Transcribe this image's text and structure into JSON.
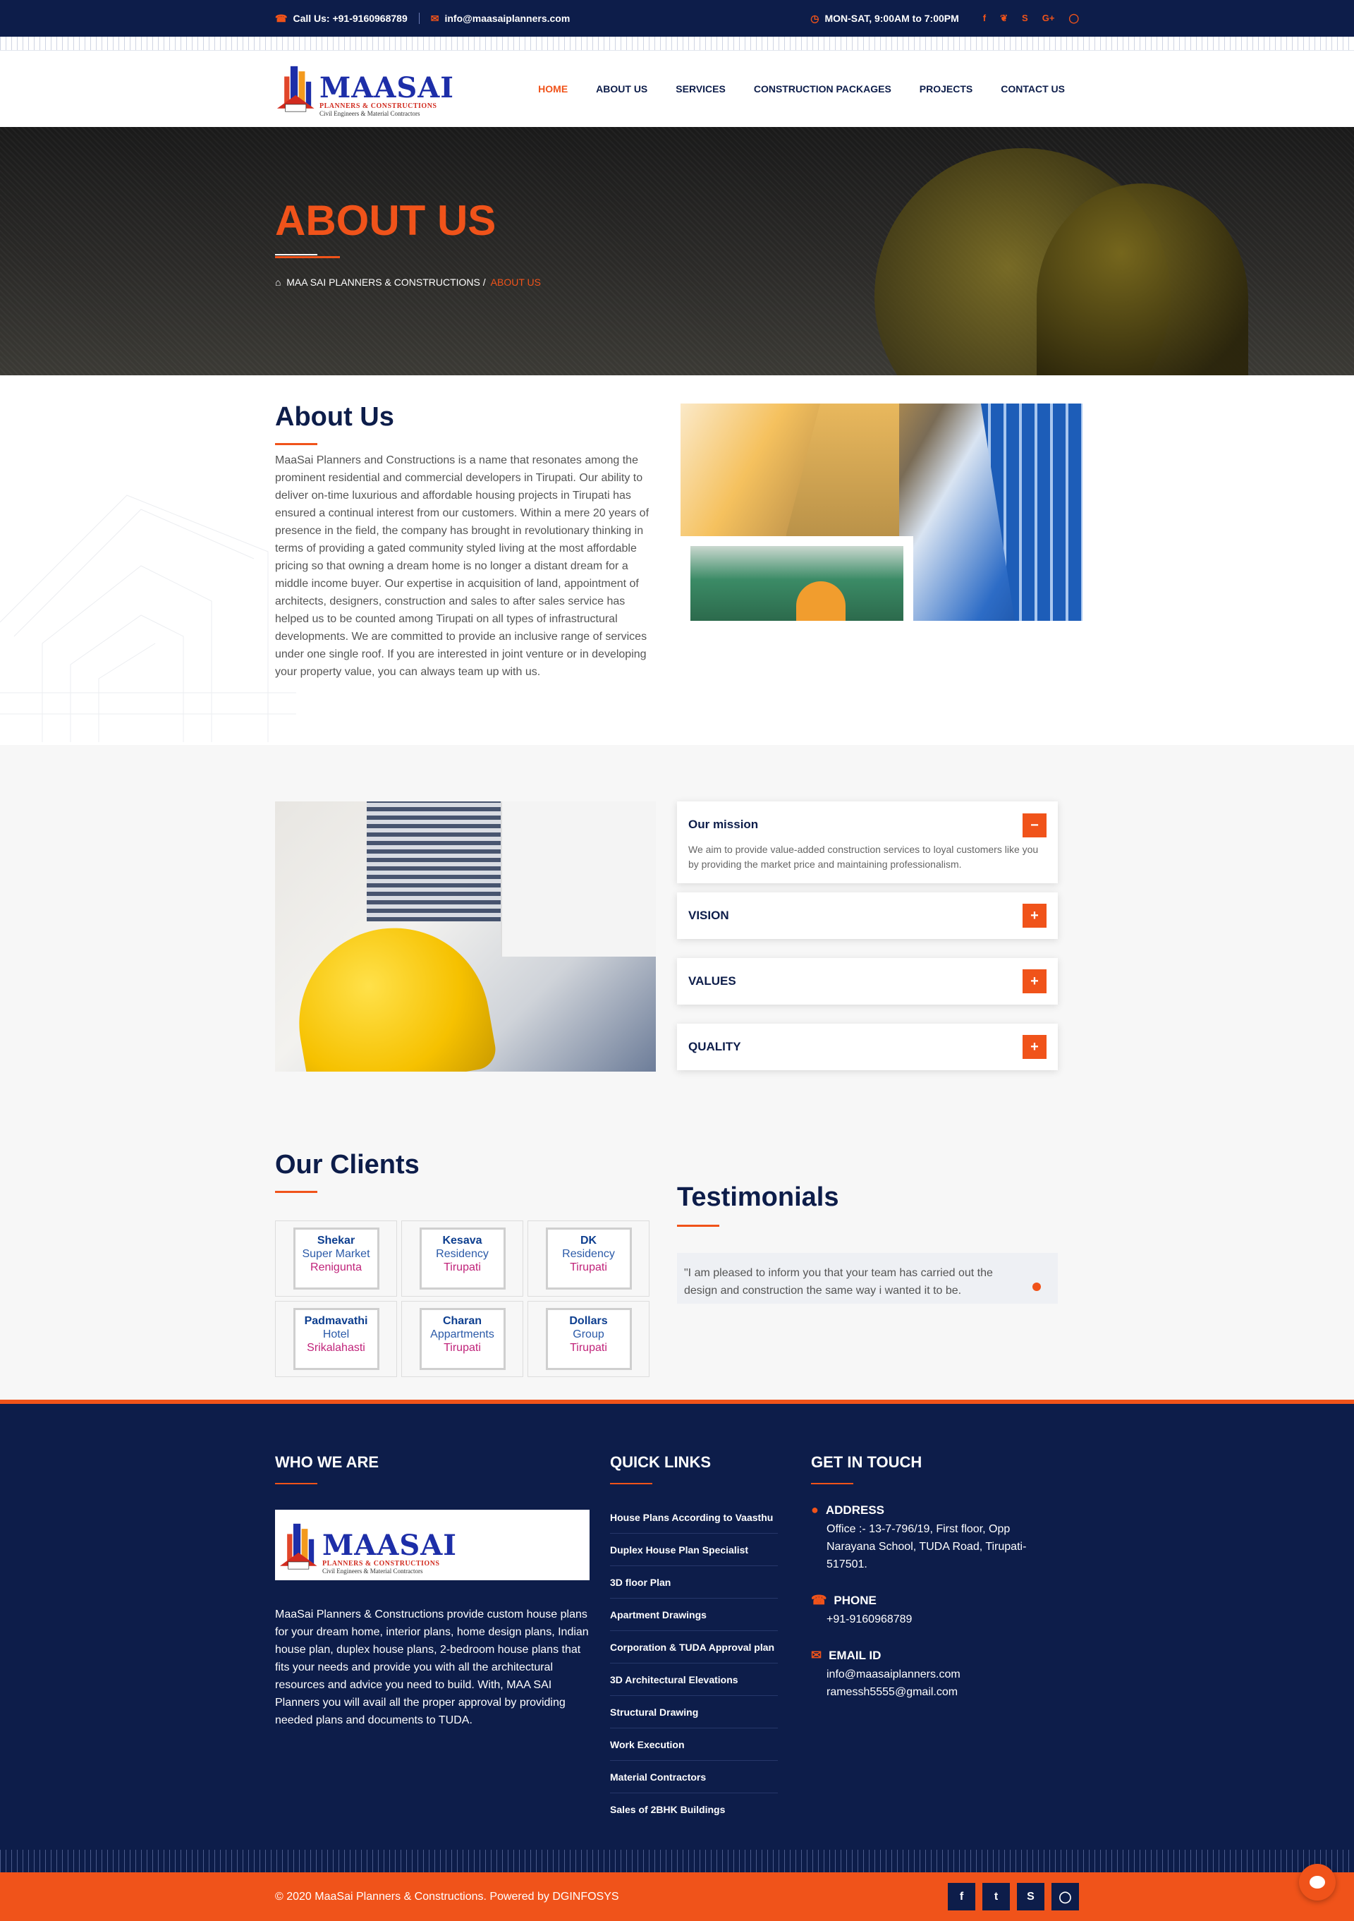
{
  "topbar": {
    "phone": "Call Us: +91-9160968789",
    "email": "info@maasaiplanners.com",
    "hours": "MON-SAT, 9:00AM to 7:00PM",
    "social_icons": [
      "facebook-icon",
      "twitter-icon",
      "skype-icon",
      "google-plus-icon",
      "instagram-icon"
    ]
  },
  "logo": {
    "title": "MAASAI",
    "sub1": "PLANNERS & CONSTRUCTIONS",
    "sub2": "Civil Engineers & Material Contractors"
  },
  "nav": [
    "HOME",
    "ABOUT US",
    "SERVICES",
    "CONSTRUCTION PACKAGES",
    "PROJECTS",
    "CONTACT US"
  ],
  "banner": {
    "title": "ABOUT US",
    "crumb_home": "MAA SAI PLANNERS & CONSTRUCTIONS",
    "crumb_sep": "/",
    "crumb_current": "ABOUT US"
  },
  "about": {
    "title": "About Us",
    "text": "MaaSai Planners and Constructions is a name that resonates among the prominent residential and commercial developers in Tirupati. Our ability to deliver on-time luxurious and affordable housing projects in Tirupati has ensured a continual interest from our customers. Within a mere 20 years of presence in the field, the company has brought in revolutionary thinking in terms of providing a gated community styled living at the most affordable pricing so that owning a dream home is no longer a distant dream for a middle income buyer. Our expertise in acquisition of land, appointment of architects, designers, construction and sales to after sales service has helped us to be counted among Tirupati on all types of infrastructural developments. We are committed to provide an inclusive range of services under one single roof. If you are interested in joint venture or in developing your property value, you can always team up with us."
  },
  "accordion": {
    "mission_title": "Our mission",
    "mission_text": "We aim to provide value-added construction services to loyal customers like you by providing the market price and maintaining professionalism.",
    "vision": "VISION",
    "values": "VALUES",
    "quality": "QUALITY",
    "minus": "−",
    "plus": "+"
  },
  "clients": {
    "title": "Our Clients",
    "items": [
      {
        "l1": "Shekar",
        "l2": "Super Market",
        "l3": "Renigunta"
      },
      {
        "l1": "Kesava",
        "l2": "Residency",
        "l3": "Tirupati"
      },
      {
        "l1": "DK",
        "l2": "Residency",
        "l3": "Tirupati"
      },
      {
        "l1": "Padmavathi",
        "l2": "Hotel",
        "l3": "Srikalahasti"
      },
      {
        "l1": "Charan",
        "l2": "Appartments",
        "l3": "Tirupati"
      },
      {
        "l1": "Dollars",
        "l2": "Group",
        "l3": "Tirupati"
      }
    ]
  },
  "testimonials": {
    "title": "Testimonials",
    "quote": "\"I am pleased to inform you that your team has carried out the design and construction the same way i wanted it to be."
  },
  "footer": {
    "who_title": "WHO WE ARE",
    "who_text": "MaaSai Planners & Constructions provide custom house plans for your dream home, interior plans, home design plans, Indian house plan, duplex house plans, 2-bedroom house plans that fits your needs and provide you with all the architectural resources and advice you need to build. With, MAA SAI Planners you will avail all the proper approval by providing needed plans and documents to TUDA.",
    "quick_title": "QUICK LINKS",
    "quick_links": [
      "House Plans According to Vaasthu",
      "Duplex House Plan Specialist",
      "3D floor Plan",
      "Apartment Drawings",
      "Corporation & TUDA Approval plan",
      "3D Architectural Elevations",
      "Structural Drawing",
      "Work Execution",
      "Material Contractors",
      "Sales of 2BHK Buildings"
    ],
    "touch_title": "GET IN TOUCH",
    "address_label": "ADDRESS",
    "address": "Office :- 13-7-796/19, First floor, Opp Narayana School, TUDA Road, Tirupati-517501.",
    "phone_label": "PHONE",
    "phone": "+91-9160968789",
    "email_label": "EMAIL ID",
    "email1": "info@maasaiplanners.com",
    "email2": "ramessh5555@gmail.com"
  },
  "bottom": {
    "copyright": "© 2020 MaaSai Planners & Constructions. Powered by DGINFOSYS",
    "social_icons": [
      "facebook-icon",
      "twitter-icon",
      "skype-icon",
      "instagram-icon"
    ]
  },
  "colors": {
    "navy": "#0d1d4a",
    "accent": "#f0531a"
  }
}
